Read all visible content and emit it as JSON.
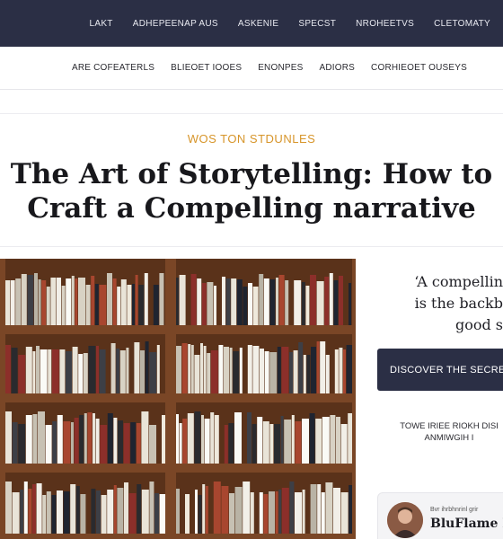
{
  "topnav": {
    "items": [
      "LAKT",
      "ADHEPEENAP AUS",
      "ASKENIE",
      "SPECST",
      "NROHEETVS",
      "CLETOMATY"
    ]
  },
  "subnav": {
    "items": [
      "ARE COFEATERLS",
      "BLIEOET IOOES",
      "ENONPES",
      "ADIORS",
      "CORHIEOET OUSEYS"
    ]
  },
  "article": {
    "kicker": "WOS TON STDUNLES",
    "title": "The Art of Storytelling: How to Craft a Compelling narrative",
    "image_alt": "Bookshelf"
  },
  "sidebar": {
    "quote": "‘A compellin\nis the backb\ngood s",
    "cta_label": "DISCOVER THE SECRE",
    "caption": "TOWE IRIEE RIOKH DISI\nANMIWGIH I",
    "author_prefix": "Bvr ihrbhnrinl grir",
    "author_name": "BluFlame P"
  },
  "colors": {
    "nav_bg": "#2b2f45",
    "accent": "#d7952a",
    "wood": "#6b3e21"
  }
}
